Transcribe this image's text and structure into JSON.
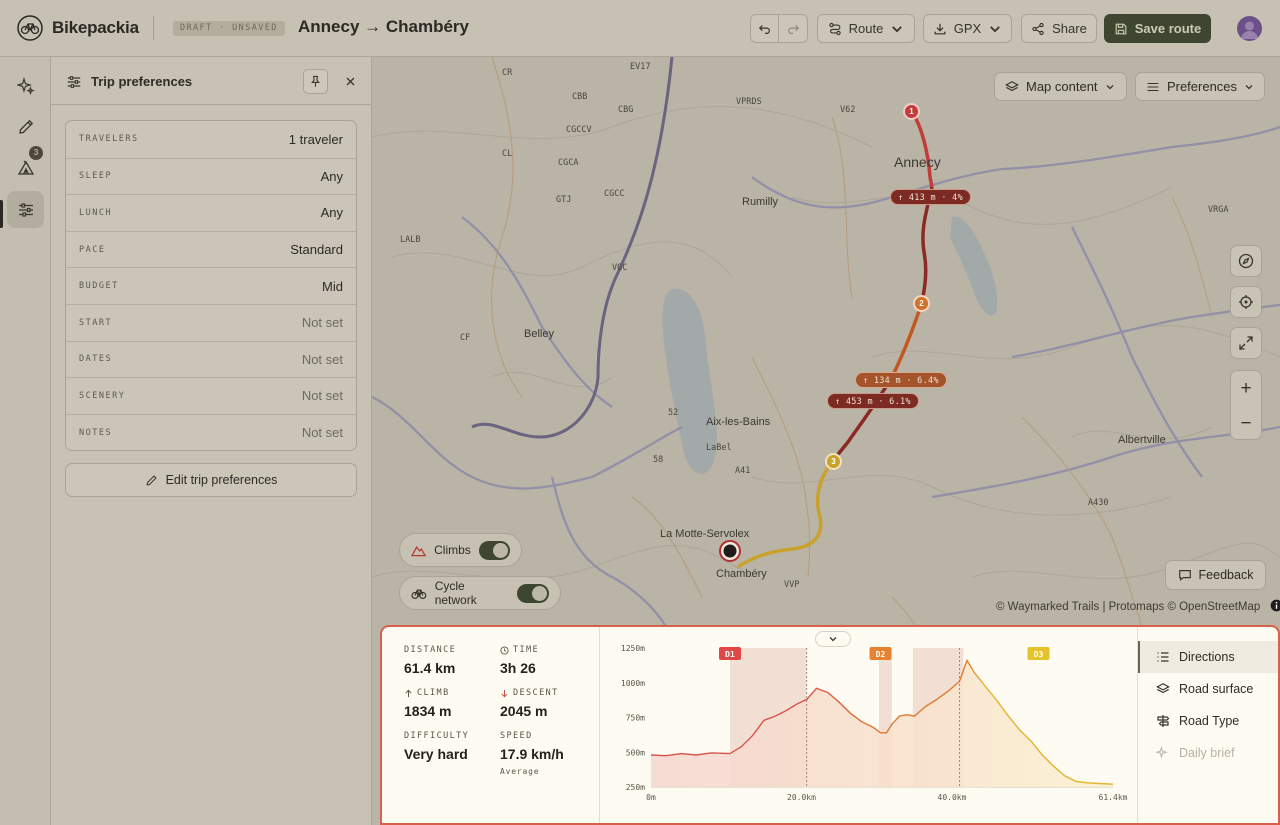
{
  "app": {
    "name": "Bikepackia",
    "draft_badge": "DRAFT · UNSAVED",
    "trip_title": "Annecy → Chambéry"
  },
  "toolbar": {
    "route_label": "Route",
    "gpx_label": "GPX",
    "share_label": "Share",
    "save_label": "Save route"
  },
  "rail": {
    "badge_count": "3"
  },
  "panel": {
    "title": "Trip preferences",
    "rows": [
      {
        "label": "TRAVELERS",
        "value": "1 traveler"
      },
      {
        "label": "SLEEP",
        "value": "Any"
      },
      {
        "label": "LUNCH",
        "value": "Any"
      },
      {
        "label": "PACE",
        "value": "Standard"
      },
      {
        "label": "BUDGET",
        "value": "Mid"
      },
      {
        "label": "START",
        "value": "Not set"
      },
      {
        "label": "DATES",
        "value": "Not set"
      },
      {
        "label": "SCENERY",
        "value": "Not set"
      },
      {
        "label": "NOTES",
        "value": "Not set"
      }
    ],
    "edit_label": "Edit trip preferences"
  },
  "map": {
    "map_content_label": "Map content",
    "preferences_label": "Preferences",
    "toggles": {
      "climbs": "Climbs",
      "cycle_network": "Cycle network"
    },
    "feedback_label": "Feedback",
    "attribution": "© Waymarked Trails | Protomaps © OpenStreetMap",
    "climb_tags": [
      "↑ 413 m · 4%",
      "↑ 134 m · 6.4%",
      "↑ 453 m · 6.1%"
    ],
    "waypoints": [
      "1",
      "2",
      "3"
    ],
    "places": [
      "Annecy",
      "Rumilly",
      "Belley",
      "Aix-les-Bains",
      "Albertville",
      "La Motte-Servolex",
      "Chambéry"
    ],
    "route_codes": [
      "EV17",
      "CR",
      "CBB",
      "CBG",
      "CGCCV",
      "CL",
      "CGCA",
      "CGCC",
      "GTJ",
      "VPRDS",
      "V62",
      "VRGA",
      "LALB",
      "VGC",
      "CF",
      "52",
      "58",
      "LaBel",
      "A41",
      "VVP",
      "A430"
    ]
  },
  "stats": {
    "distance": {
      "label": "DISTANCE",
      "value": "61.4 km"
    },
    "time": {
      "label": "TIME",
      "value": "3h 26"
    },
    "climb": {
      "label": "CLIMB",
      "value": "1834 m"
    },
    "descent": {
      "label": "DESCENT",
      "value": "2045 m"
    },
    "difficulty": {
      "label": "DIFFICULTY",
      "value": "Very hard"
    },
    "speed": {
      "label": "SPEED",
      "value": "17.9 km/h",
      "sub": "Average"
    }
  },
  "side_tabs": [
    "Directions",
    "Road surface",
    "Road Type",
    "Daily brief"
  ],
  "chart_data": {
    "type": "area",
    "title": "",
    "xlabel": "",
    "ylabel": "",
    "x_unit": "km",
    "y_unit": "m",
    "xlim": [
      0,
      61.4
    ],
    "ylim": [
      250,
      1250
    ],
    "x_ticks": [
      "0m",
      "20.0km",
      "40.0km",
      "61.4km"
    ],
    "y_ticks": [
      "1250m",
      "1000m",
      "750m",
      "500m",
      "250m"
    ],
    "day_markers": [
      {
        "label": "D1",
        "x": 10.5,
        "color": "#e04848"
      },
      {
        "label": "D2",
        "x": 30.5,
        "color": "#e8822e"
      },
      {
        "label": "D3",
        "x": 51.5,
        "color": "#e6c32a"
      }
    ],
    "climb_sections": [
      [
        10.5,
        20.7
      ],
      [
        30.3,
        32.0
      ],
      [
        34.8,
        41.5
      ]
    ],
    "day_boundaries": [
      20.7,
      41.0
    ],
    "series": [
      {
        "x": [
          0,
          2,
          4,
          6,
          8,
          10.5,
          12,
          13.5,
          15,
          16.5,
          18,
          19.5,
          20.7,
          22,
          23.5,
          25,
          26.5,
          28,
          29.5,
          30.5,
          31.3,
          32,
          33,
          34,
          35,
          36.5,
          38,
          39.5,
          41,
          42,
          43,
          44.5,
          46,
          47.5,
          49,
          50.5,
          52,
          53.5,
          55,
          56.5,
          58,
          59.5,
          61.4
        ],
        "y": [
          480,
          475,
          490,
          480,
          495,
          490,
          540,
          620,
          730,
          760,
          800,
          850,
          880,
          960,
          930,
          860,
          780,
          720,
          680,
          640,
          640,
          700,
          760,
          770,
          760,
          830,
          880,
          940,
          1010,
          1160,
          1070,
          970,
          870,
          760,
          660,
          580,
          480,
          400,
          330,
          290,
          280,
          275,
          270
        ]
      }
    ]
  }
}
